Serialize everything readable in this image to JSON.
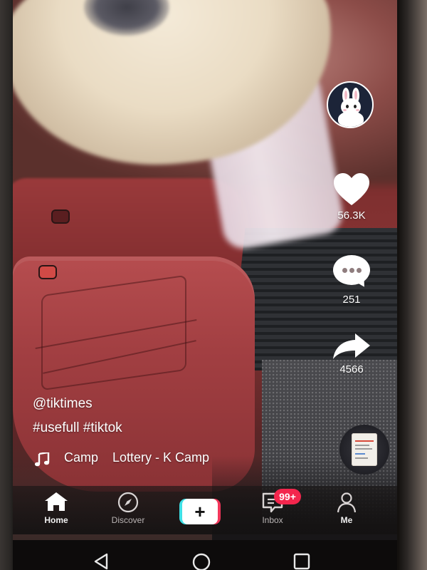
{
  "video": {
    "description": ""
  },
  "right_rail": {
    "avatar_icon": "bunny-avatar-icon",
    "likes_count": "56.3K",
    "comments_count": "251",
    "shares_count": "4566",
    "music_disc_icon": "album-cover-icon"
  },
  "caption": {
    "username": "@tiktimes",
    "hashtags": "#usefull #tiktok",
    "music_text": "Camp    Lottery - K Camp"
  },
  "tabbar": {
    "home_label": "Home",
    "discover_label": "Discover",
    "create_label": "+",
    "inbox_label": "Inbox",
    "inbox_badge": "99+",
    "me_label": "Me"
  },
  "colors": {
    "accent_pink": "#f3264d",
    "create_cyan": "#3ee0e6",
    "create_pink": "#f2365a",
    "text_white": "#ffffff"
  }
}
